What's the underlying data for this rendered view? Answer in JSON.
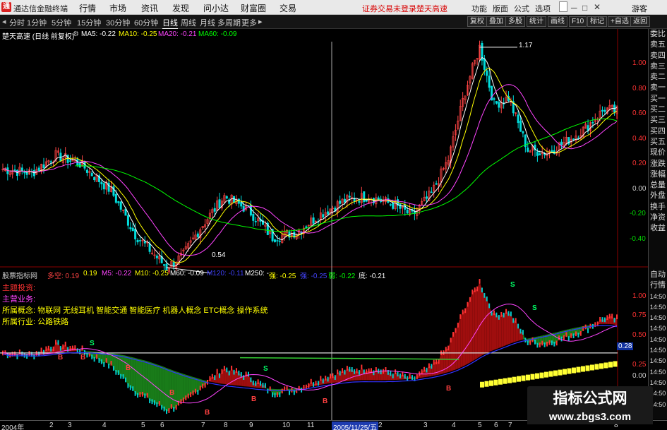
{
  "app": {
    "logo_char": "通",
    "name": "通达信金融终端"
  },
  "menu": [
    "行情",
    "市场",
    "资讯",
    "发现",
    "问小达",
    "财富圈",
    "交易"
  ],
  "warning": "证券交易未登录",
  "warning2": "楚天高速",
  "right_menu": [
    "功能",
    "版面",
    "公式",
    "选项"
  ],
  "guest": "游客",
  "periods": [
    "分时",
    "1分钟",
    "5分钟",
    "15分钟",
    "30分钟",
    "60分钟",
    "日线",
    "周线",
    "月线",
    "多周期",
    "更多"
  ],
  "active_period": "日线",
  "right_buttons": [
    "复权",
    "叠加",
    "多股",
    "统计",
    "画线",
    "F10",
    "标记",
    "+自选",
    "返回"
  ],
  "main_panel": {
    "stock_title": "楚天高速 (日线 前复权)",
    "ma_labels": [
      {
        "text": "MA5: -0.22",
        "color": "#ffffff"
      },
      {
        "text": "MA10: -0.25",
        "color": "#ffff00"
      },
      {
        "text": "MA20: -0.21",
        "color": "#ff44ff"
      },
      {
        "text": "MA60: -0.09",
        "color": "#00ff00"
      }
    ],
    "y_ticks": [
      "1.00",
      "0.80",
      "0.60",
      "0.40",
      "0.20",
      "0.00",
      "-0.20",
      "-0.40"
    ],
    "annot_high": "1.17",
    "annot_low": "0.54"
  },
  "sub_panel": {
    "title": "股票指标网",
    "labels": [
      {
        "text": "多空: 0.19",
        "color": "#ff4444"
      },
      {
        "text": "0.19",
        "color": "#ffff00"
      },
      {
        "text": "M5: -0.22",
        "color": "#ff44ff"
      },
      {
        "text": "M10: -0.25",
        "color": "#ffff00"
      },
      {
        "text": "M60: -0.09",
        "color": "#ffffff"
      },
      {
        "text": "M120: -0.11",
        "color": "#4040ff"
      },
      {
        "text": "M250: -",
        "color": "#ffffff"
      },
      {
        "text": "强: -0.25",
        "color": "#ffff00"
      },
      {
        "text": "强: -0.25",
        "color": "#4444ff"
      },
      {
        "text": "弱: -0.22",
        "color": "#00ff00"
      },
      {
        "text": "底: -0.21",
        "color": "#ffffff"
      }
    ],
    "info_lines": [
      {
        "text": "主题投资:",
        "color": "#ff3333"
      },
      {
        "text": "主营业务:",
        "color": "#ff44ff"
      },
      {
        "text": "所属概念: 物联网 无线耳机 智能交通 智能医疗 机器人概念 ETC概念 操作系统",
        "color": "#ffff00"
      },
      {
        "text": "所属行业: 公路铁路",
        "color": "#ffff00"
      }
    ],
    "y_ticks": [
      "1.00",
      "0.75",
      "0.50",
      "0.25",
      "0.00"
    ],
    "value_tag": "0.28",
    "s_marks": [
      "S",
      "S",
      "S",
      "S"
    ],
    "b_marks": [
      "B",
      "B",
      "B",
      "B",
      "B",
      "B",
      "B",
      "B"
    ]
  },
  "side_panel": [
    "委比",
    "卖五",
    "卖四",
    "卖三",
    "卖二",
    "卖一",
    "买一",
    "买二",
    "买三",
    "买四",
    "买五",
    "现价",
    "涨跌",
    "涨幅",
    "总量",
    "外盘",
    "换手",
    "净资",
    "收益"
  ],
  "side_panel2": [
    "自动",
    "行情",
    "14:50",
    "14:50",
    "14:50",
    "14:50",
    "14:50",
    "14:50",
    "14:50",
    "14:50",
    "14:50",
    "14:50",
    "14:50"
  ],
  "x_axis": [
    "2004年",
    "2",
    "3",
    "4",
    "5",
    "6",
    "7",
    "8",
    "9",
    "10",
    "11",
    "2005/11/25/五",
    "2",
    "3",
    "4",
    "5",
    "6",
    "7",
    "8"
  ],
  "watermark": {
    "line1": "指标公式网",
    "line2": "www.zbgs3.com"
  },
  "chart_data": {
    "type": "line",
    "title": "楚天高速 (日线 前复权)",
    "ylim": [
      -0.4,
      1.2
    ],
    "series": [
      {
        "name": "MA5",
        "color": "#ffffff"
      },
      {
        "name": "MA10",
        "color": "#ffff00"
      },
      {
        "name": "MA20",
        "color": "#ff44ff"
      },
      {
        "name": "MA60",
        "color": "#00ff00"
      }
    ],
    "key_points": [
      {
        "i": 0,
        "v": 0.28
      },
      {
        "i": 12,
        "v": 0.25
      },
      {
        "i": 22,
        "v": 0.38
      },
      {
        "i": 32,
        "v": 0.32
      },
      {
        "i": 45,
        "v": 0.12
      },
      {
        "i": 55,
        "v": -0.2
      },
      {
        "i": 68,
        "v": -0.44
      },
      {
        "i": 75,
        "v": -0.35
      },
      {
        "i": 82,
        "v": -0.15
      },
      {
        "i": 92,
        "v": 0.08
      },
      {
        "i": 102,
        "v": -0.02
      },
      {
        "i": 112,
        "v": -0.22
      },
      {
        "i": 122,
        "v": -0.18
      },
      {
        "i": 132,
        "v": -0.05
      },
      {
        "i": 142,
        "v": 0.05
      },
      {
        "i": 152,
        "v": 0.08
      },
      {
        "i": 162,
        "v": 0.02
      },
      {
        "i": 170,
        "v": -0.06
      },
      {
        "i": 178,
        "v": 0.1
      },
      {
        "i": 185,
        "v": 0.35
      },
      {
        "i": 192,
        "v": 0.85
      },
      {
        "i": 198,
        "v": 1.17
      },
      {
        "i": 204,
        "v": 0.75
      },
      {
        "i": 210,
        "v": 0.8
      },
      {
        "i": 218,
        "v": 0.42
      },
      {
        "i": 226,
        "v": 0.4
      },
      {
        "i": 234,
        "v": 0.48
      },
      {
        "i": 242,
        "v": 0.58
      },
      {
        "i": 250,
        "v": 0.72
      },
      {
        "i": 255,
        "v": 0.7
      }
    ],
    "high": 1.17,
    "low": 0.54
  }
}
